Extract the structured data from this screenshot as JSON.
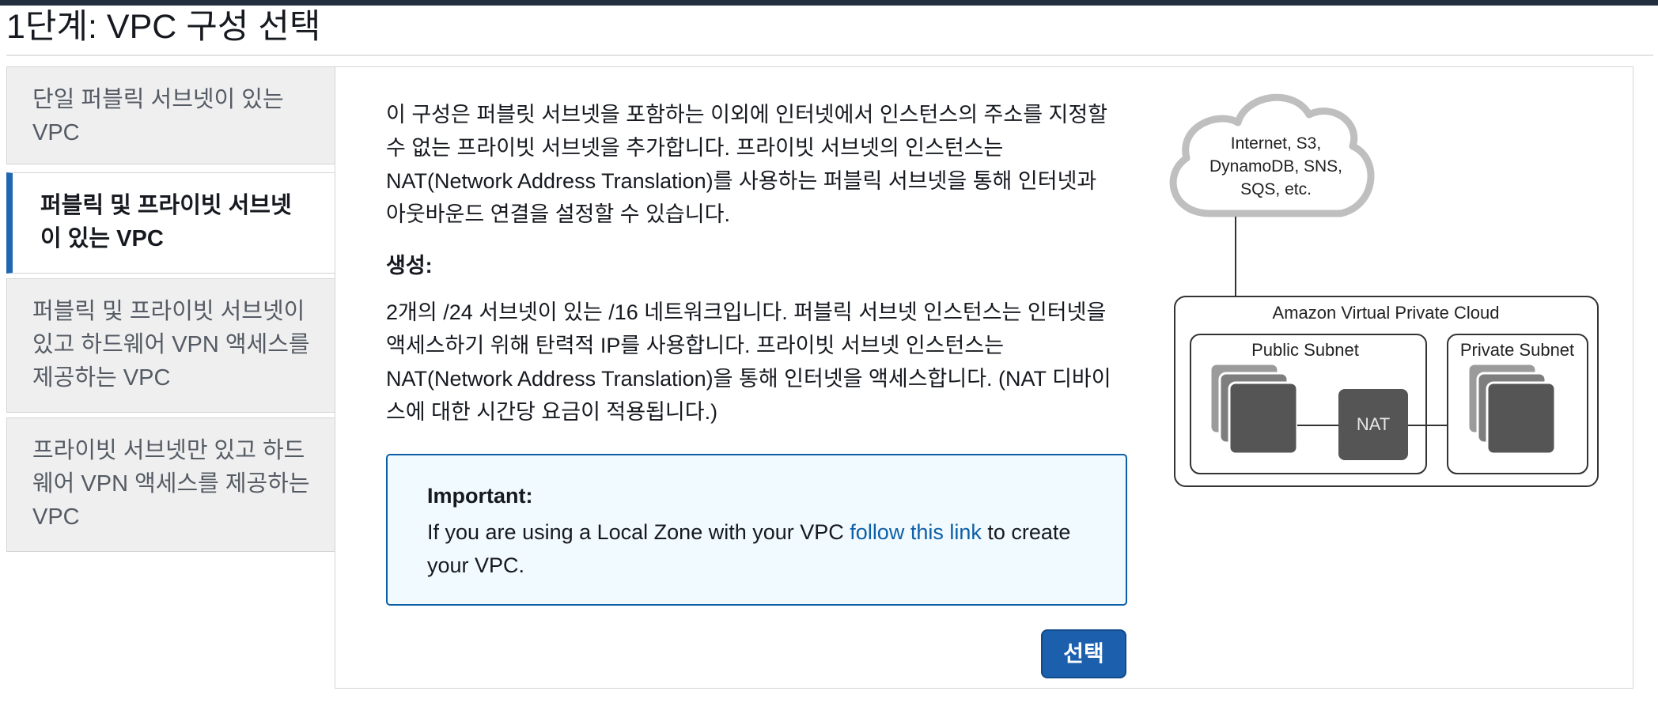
{
  "page": {
    "title": "1단계: VPC 구성 선택"
  },
  "tabs": [
    {
      "label": "단일 퍼블릭 서브넷이 있는 VPC",
      "active": false
    },
    {
      "label": "퍼블릭 및 프라이빗 서브넷이 있는 VPC",
      "active": true
    },
    {
      "label": "퍼블릭 및 프라이빗 서브넷이 있고 하드웨어 VPN 액세스를 제공하는 VPC",
      "active": false
    },
    {
      "label": "프라이빗 서브넷만 있고 하드웨어 VPN 액세스를 제공하는 VPC",
      "active": false
    }
  ],
  "main": {
    "description": "이 구성은 퍼블릿 서브넷을 포함하는 이외에 인터넷에서 인스턴스의 주소를 지정할 수 없는 프라이빗 서브넷을 추가합니다. 프라이빗 서브넷의 인스턴스는 NAT(Network Address Translation)를 사용하는 퍼블릭 서브넷을 통해 인터넷과 아웃바운드 연결을 설정할 수 있습니다.",
    "generation_title": "생성:",
    "generation_text": "2개의 /24 서브넷이 있는 /16 네트워크입니다. 퍼블릭 서브넷 인스턴스는 인터넷을 액세스하기 위해 탄력적 IP를 사용합니다. 프라이빗 서브넷 인스턴스는 NAT(Network Address Translation)을 통해 인터넷을 액세스합니다. (NAT 디바이스에 대한 시간당 요금이 적용됩니다.)",
    "notice": {
      "title": "Important:",
      "text_before": "If you are using a Local Zone with your VPC",
      "link": "follow this link",
      "text_after": "to create your VPC."
    },
    "select_button": "선택"
  },
  "diagram": {
    "cloud_line1": "Internet, S3,",
    "cloud_line2": "DynamoDB, SNS,",
    "cloud_line3": "SQS, etc.",
    "vpc_label": "Amazon Virtual Private Cloud",
    "public_subnet": "Public Subnet",
    "private_subnet": "Private Subnet",
    "nat_label": "NAT"
  }
}
